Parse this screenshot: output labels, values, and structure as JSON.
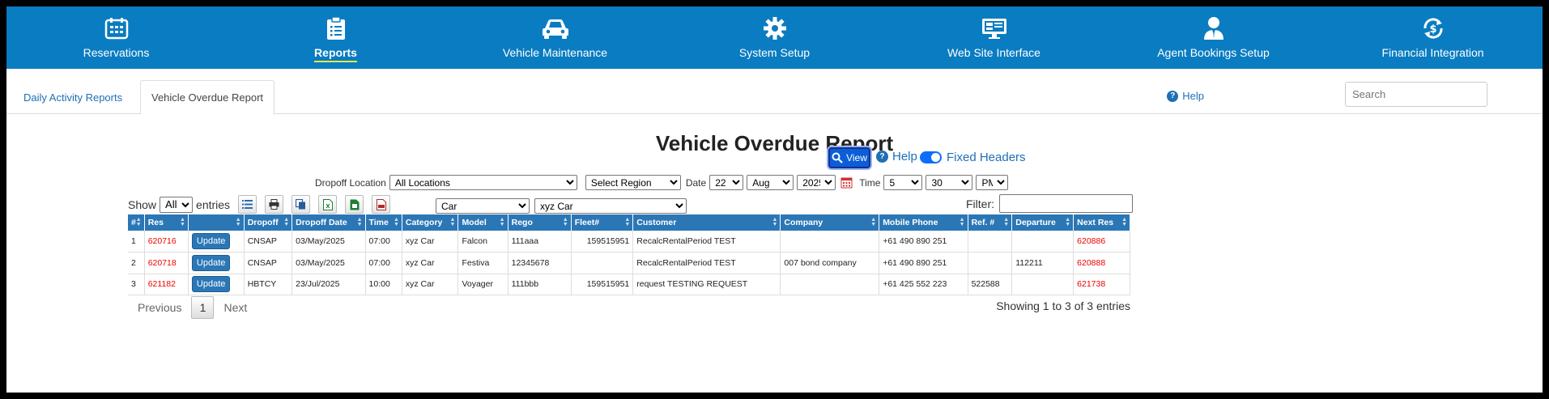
{
  "nav": [
    {
      "label": "Reservations",
      "icon": "calendar-icon",
      "active": false
    },
    {
      "label": "Reports",
      "icon": "clipboard-icon",
      "active": true
    },
    {
      "label": "Vehicle Maintenance",
      "icon": "car-icon",
      "active": false
    },
    {
      "label": "System Setup",
      "icon": "gear-icon",
      "active": false
    },
    {
      "label": "Web Site Interface",
      "icon": "monitor-icon",
      "active": false
    },
    {
      "label": "Agent Bookings Setup",
      "icon": "agent-icon",
      "active": false
    },
    {
      "label": "Financial Integration",
      "icon": "dollar-cycle-icon",
      "active": false
    }
  ],
  "tabs": {
    "daily": "Daily Activity Reports",
    "overdue": "Vehicle Overdue Report"
  },
  "help_label": "Help",
  "search_placeholder": "Search",
  "page_title": "Vehicle Overdue Report",
  "filters": {
    "dropoff_label": "Dropoff Location",
    "dropoff_value": "All Locations",
    "region_value": "Select Region",
    "date_label": "Date",
    "day": "22",
    "month": "Aug",
    "year": "2025",
    "time_label": "Time",
    "hour": "5",
    "minute": "30",
    "ampm": "PM",
    "vehicle_type": "Car",
    "vehicle_category": "xyz Car",
    "view_label": "View",
    "help_label": "Help",
    "fixed_headers_label": "Fixed Headers"
  },
  "table_controls": {
    "show_label": "Show",
    "show_value": "All",
    "entries_label": "entries",
    "filter_label": "Filter:"
  },
  "columns": [
    "#",
    "Res",
    "",
    "Dropoff",
    "Dropoff Date",
    "Time",
    "Category",
    "Model",
    "Rego",
    "Fleet#",
    "Customer",
    "Company",
    "Mobile Phone",
    "Ref. #",
    "Departure",
    "Next Res"
  ],
  "rows": [
    {
      "n": "1",
      "res": "620716",
      "update": "Update",
      "dropoff": "CNSAP",
      "date": "03/May/2025",
      "time": "07:00",
      "category": "xyz Car",
      "model": "Falcon",
      "rego": "111aaa",
      "fleet": "159515951",
      "customer": "RecalcRentalPeriod TEST",
      "company": "",
      "phone": "+61 490 890 251",
      "ref": "",
      "departure": "",
      "next": "620886"
    },
    {
      "n": "2",
      "res": "620718",
      "update": "Update",
      "dropoff": "CNSAP",
      "date": "03/May/2025",
      "time": "07:00",
      "category": "xyz Car",
      "model": "Festiva",
      "rego": "12345678",
      "fleet": "",
      "customer": "RecalcRentalPeriod TEST",
      "company": "007 bond company",
      "phone": "+61 490 890 251",
      "ref": "",
      "departure": "112211",
      "next": "620888"
    },
    {
      "n": "3",
      "res": "621182",
      "update": "Update",
      "dropoff": "HBTCY",
      "date": "23/Jul/2025",
      "time": "10:00",
      "category": "xyz Car",
      "model": "Voyager",
      "rego": "111bbb",
      "fleet": "159515951",
      "customer": "request TESTING REQUEST",
      "company": "",
      "phone": "+61 425 552 223",
      "ref": "522588",
      "departure": "",
      "next": "621738"
    }
  ],
  "pager": {
    "previous": "Previous",
    "current": "1",
    "next": "Next",
    "showing": "Showing 1 to 3 of 3 entries"
  }
}
